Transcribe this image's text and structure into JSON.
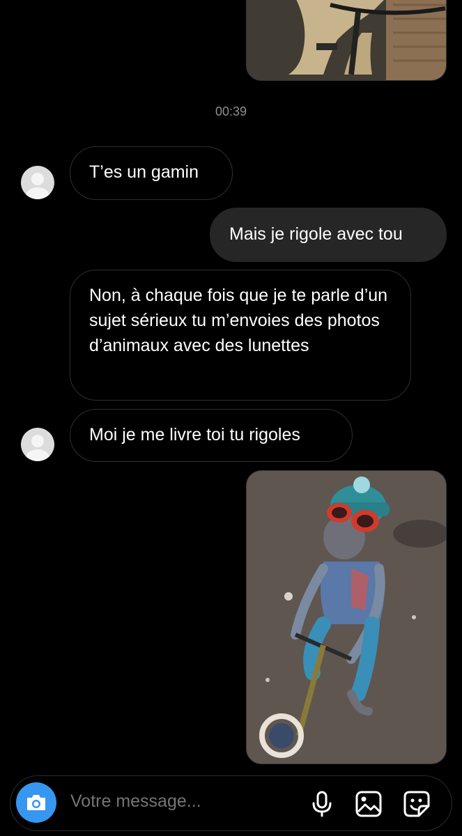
{
  "timestamp": "00:39",
  "messages": [
    {
      "direction": "incoming",
      "text": "T’es un gamin"
    },
    {
      "direction": "outgoing",
      "text": "Mais je rigole avec tou"
    },
    {
      "direction": "incoming",
      "text": "Non, à chaque fois que je te parle d’un sujet sérieux tu m’envoies des photos d’animaux avec des lunettes"
    },
    {
      "direction": "incoming",
      "text": "Moi je me livre toi tu rigoles"
    }
  ],
  "composer": {
    "placeholder": "Votre message...",
    "icons": [
      "camera-icon",
      "microphone-icon",
      "gallery-icon",
      "sticker-icon"
    ]
  },
  "colors": {
    "background": "#000000",
    "outgoing_bubble": "#262626",
    "incoming_border": "#2f2f2f",
    "camera_button": "#3797f0",
    "secondary_text": "#8e8e93"
  }
}
